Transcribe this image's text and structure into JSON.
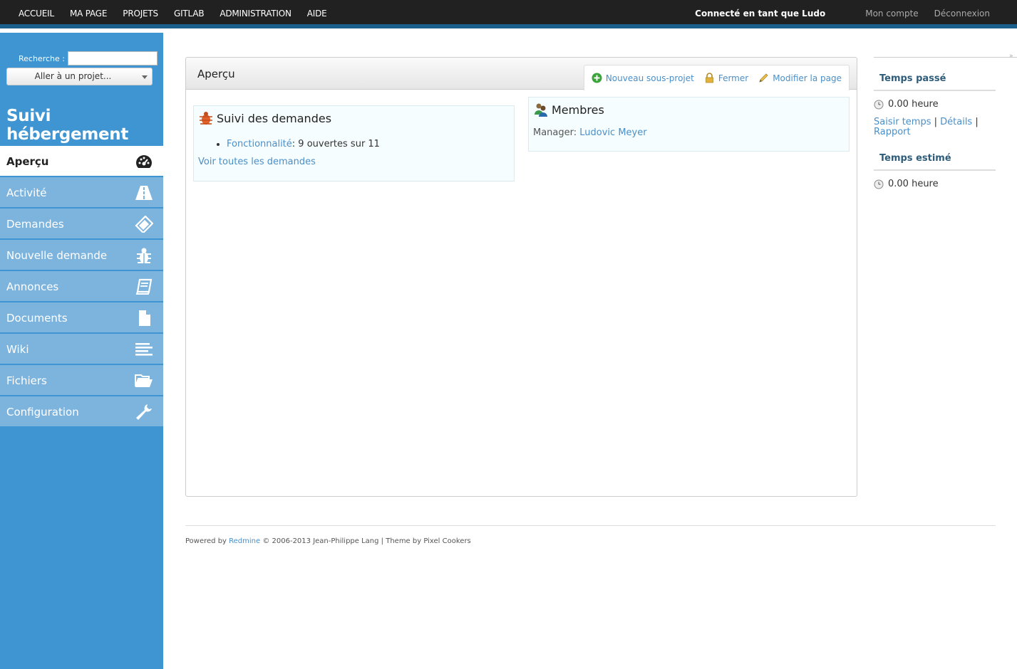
{
  "top_menu": {
    "items": [
      "ACCUEIL",
      "MA PAGE",
      "PROJETS",
      "GITLAB",
      "ADMINISTRATION",
      "AIDE"
    ],
    "logged_as": "Connecté en tant que Ludo",
    "my_account": "Mon compte",
    "logout": "Déconnexion"
  },
  "sidebar": {
    "search_label": "Recherche :",
    "search_value": "",
    "jump_label": "Aller à un projet...",
    "project_title": "Suivi hébergement",
    "menu": [
      {
        "label": "Aperçu",
        "icon": "dashboard-icon",
        "selected": true
      },
      {
        "label": "Activité",
        "icon": "road-icon"
      },
      {
        "label": "Demandes",
        "icon": "ticket-icon"
      },
      {
        "label": "Nouvelle demande",
        "icon": "bug-icon"
      },
      {
        "label": "Annonces",
        "icon": "book-icon"
      },
      {
        "label": "Documents",
        "icon": "document-icon"
      },
      {
        "label": "Wiki",
        "icon": "list-icon"
      },
      {
        "label": "Fichiers",
        "icon": "folder-open-icon"
      },
      {
        "label": "Configuration",
        "icon": "wrench-icon"
      }
    ]
  },
  "content": {
    "title": "Aperçu",
    "actions": {
      "new_subproject": "Nouveau sous-projet",
      "close": "Fermer",
      "edit_page": "Modifier la page"
    },
    "issues": {
      "heading": "Suivi des demandes",
      "tracker_link": "Fonctionnalité",
      "tracker_count": ": 9 ouvertes sur 11",
      "view_all": "Voir toutes les demandes"
    },
    "members": {
      "heading": "Membres",
      "role": "Manager: ",
      "name": "Ludovic Meyer"
    }
  },
  "right_sidebar": {
    "spent_heading": "Temps passé",
    "spent_value": "0.00 heure",
    "log_time": "Saisir temps",
    "details": "Détails",
    "report": "Rapport",
    "sep": " | ",
    "estimated_heading": "Temps estimé",
    "estimated_value": "0.00 heure"
  },
  "footer": {
    "powered_by": "Powered by ",
    "redmine": "Redmine",
    "rest": " © 2006-2013 Jean-Philippe Lang | Theme by Pixel Cookers"
  },
  "colors": {
    "topbar": "#212121",
    "sidebar": "#3e95d1",
    "menu_item": "#7db4de",
    "link": "#4a8fc8"
  }
}
